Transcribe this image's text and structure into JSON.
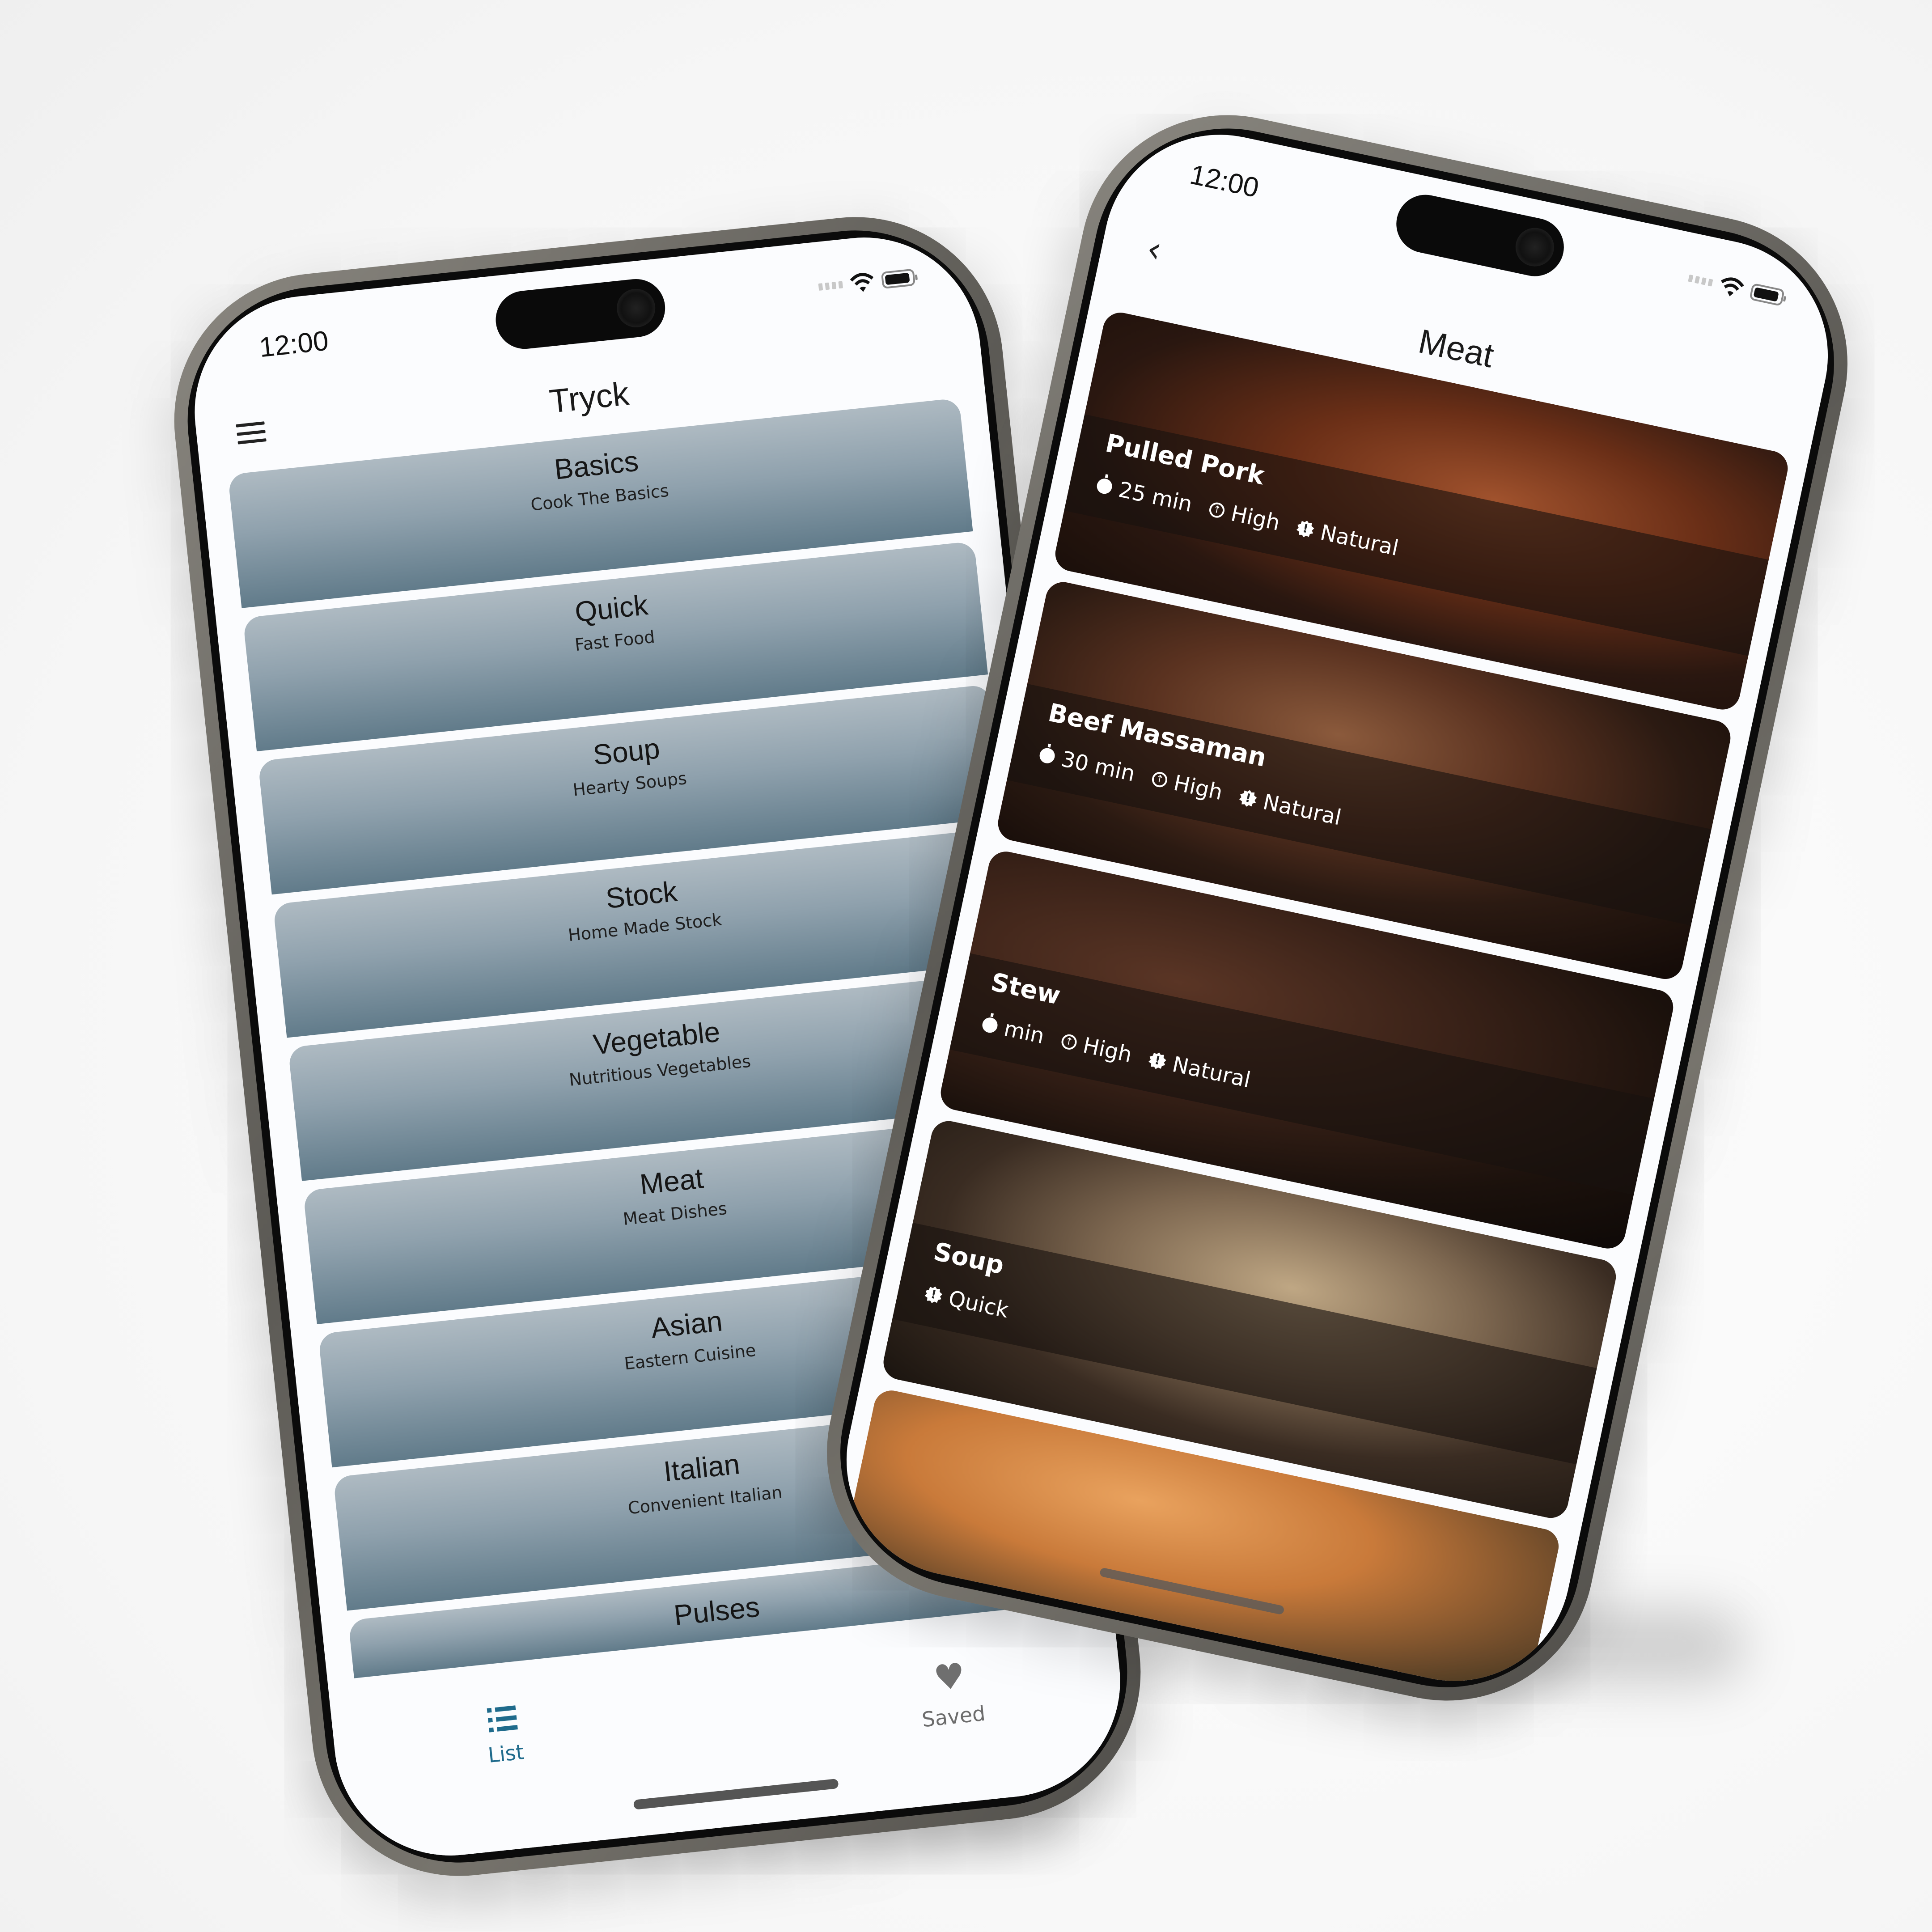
{
  "left_phone": {
    "status": {
      "time": "12:00"
    },
    "header": {
      "title": "Tryck",
      "menu_icon": "hamburger-menu-icon"
    },
    "categories": [
      {
        "title": "Basics",
        "subtitle": "Cook The Basics"
      },
      {
        "title": "Quick",
        "subtitle": "Fast Food"
      },
      {
        "title": "Soup",
        "subtitle": "Hearty Soups"
      },
      {
        "title": "Stock",
        "subtitle": "Home Made Stock"
      },
      {
        "title": "Vegetable",
        "subtitle": "Nutritious Vegetables"
      },
      {
        "title": "Meat",
        "subtitle": "Meat Dishes"
      },
      {
        "title": "Asian",
        "subtitle": "Eastern Cuisine"
      },
      {
        "title": "Italian",
        "subtitle": "Convenient Italian"
      },
      {
        "title": "Pulses",
        "subtitle": ""
      }
    ],
    "bottom_nav": [
      {
        "label": "List",
        "icon": "list-icon",
        "active": true,
        "color": "#1f6b8c"
      },
      {
        "label": "Saved",
        "icon": "heart-icon",
        "active": false,
        "color": "#6c6c6c"
      }
    ],
    "card_gradient": [
      "#aebac2",
      "#617b8a"
    ]
  },
  "right_phone": {
    "status": {
      "time": "12:00"
    },
    "header": {
      "title": "Meat",
      "back_icon": "chevron-left-icon",
      "back_glyph": "‹"
    },
    "recipes": [
      {
        "name": "Pulled Pork",
        "time": "25 min",
        "level": "High",
        "release": "Natural"
      },
      {
        "name": "Beef Massaman",
        "time": "30 min",
        "level": "High",
        "release": "Natural"
      },
      {
        "name": "Stew",
        "time": "min",
        "level": "High",
        "release": "Natural"
      },
      {
        "name": "Soup",
        "release": "Quick"
      },
      {
        "name": ""
      }
    ]
  },
  "icons": {
    "heart": "♥",
    "up_arrow": "↑",
    "badge": "!"
  }
}
